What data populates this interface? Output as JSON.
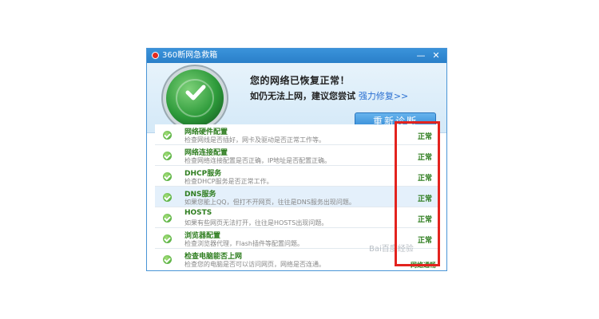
{
  "window": {
    "title": "360断网急救箱",
    "minimize": "—",
    "close": "✕"
  },
  "status": {
    "title": "您的网络已恢复正常！",
    "subtitle": "如仍无法上网，建议您尝试",
    "repair_link": "强力修复>>",
    "button": "重新诊断"
  },
  "checks": [
    {
      "title": "网络硬件配置",
      "desc": "检查网线是否插好，网卡及驱动是否正常工作等。",
      "status": "正常"
    },
    {
      "title": "网络连接配置",
      "desc": "检查网络连接配置是否正确，IP地址是否配置正确。",
      "status": "正常"
    },
    {
      "title": "DHCP服务",
      "desc": "检查DHCP服务是否正常工作。",
      "status": "正常"
    },
    {
      "title": "DNS服务",
      "desc": "如果您能上QQ，但打不开网页，往往是DNS服务出现问题。",
      "status": "正常"
    },
    {
      "title": "HOSTS",
      "desc": "如果有些网页无法打开，往往是HOSTS出现问题。",
      "status": "正常"
    },
    {
      "title": "浏览器配置",
      "desc": "检查浏览器代理，Flash插件等配置问题。",
      "status": "正常"
    },
    {
      "title": "检查电脑能否上网",
      "desc": "检查您的电脑是否可以访问网页，网络是否连通。",
      "status": "网络通畅"
    }
  ],
  "watermark": "Bai百度经验",
  "colors": {
    "accent": "#2a7fc9",
    "ok_green": "#2e7d1f",
    "annotation_red": "#e3231e"
  }
}
